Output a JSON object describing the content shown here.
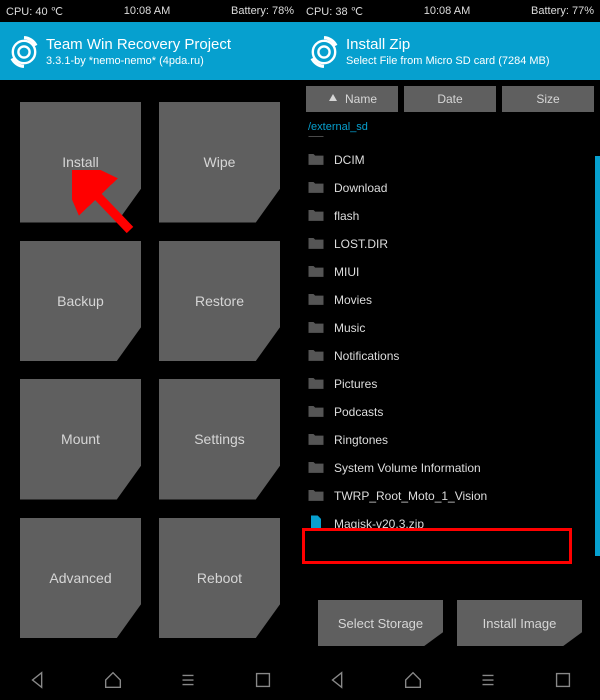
{
  "left": {
    "status": {
      "cpu": "CPU: 40 ℃",
      "time": "10:08 AM",
      "battery": "Battery: 78%"
    },
    "header": {
      "title": "Team Win Recovery Project",
      "subtitle": "3.3.1-by *nemo-nemo* (4pda.ru)"
    },
    "tiles": [
      "Install",
      "Wipe",
      "Backup",
      "Restore",
      "Mount",
      "Settings",
      "Advanced",
      "Reboot"
    ]
  },
  "right": {
    "status": {
      "cpu": "CPU: 38 ℃",
      "time": "10:08 AM",
      "battery": "Battery: 77%"
    },
    "header": {
      "title": "Install Zip",
      "subtitle": "Select File from Micro SD card (7284 MB)"
    },
    "sort": {
      "name": "Name",
      "date": "Date",
      "size": "Size"
    },
    "path": "/external_sd",
    "files": [
      {
        "type": "folder",
        "label": "Ar r o",
        "cut": true
      },
      {
        "type": "folder",
        "label": "DCIM"
      },
      {
        "type": "folder",
        "label": "Download"
      },
      {
        "type": "folder",
        "label": "flash"
      },
      {
        "type": "folder",
        "label": "LOST.DIR"
      },
      {
        "type": "folder",
        "label": "MIUI"
      },
      {
        "type": "folder",
        "label": "Movies"
      },
      {
        "type": "folder",
        "label": "Music"
      },
      {
        "type": "folder",
        "label": "Notifications"
      },
      {
        "type": "folder",
        "label": "Pictures"
      },
      {
        "type": "folder",
        "label": "Podcasts"
      },
      {
        "type": "folder",
        "label": "Ringtones"
      },
      {
        "type": "folder",
        "label": "System Volume Information"
      },
      {
        "type": "folder",
        "label": "TWRP_Root_Moto_1_Vision"
      },
      {
        "type": "file",
        "label": "Magisk-v20.3.zip"
      }
    ],
    "buttons": {
      "storage": "Select Storage",
      "image": "Install Image"
    }
  }
}
